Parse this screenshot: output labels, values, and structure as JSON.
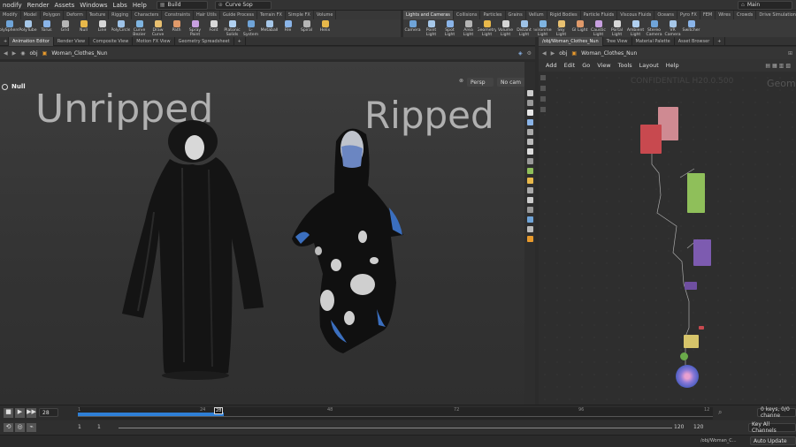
{
  "menubar": {
    "items": [
      "nodify",
      "Render",
      "Assets",
      "Windows",
      "Labs",
      "Help"
    ],
    "desktop": "Build",
    "network_selector": "Curve Sop",
    "right_label": "Main"
  },
  "shelf_left": {
    "tabs": [
      "Modify",
      "Model",
      "Polygon",
      "Deform",
      "Texture",
      "Rigging",
      "Characters",
      "Constraints",
      "Hair Utils",
      "Guide Process",
      "Terrain FX",
      "Simple FX",
      "Volume"
    ],
    "tools": [
      "olySphere",
      "PolyTube",
      "Torus",
      "Grid",
      "Null",
      "Line",
      "PolyCircle",
      "Curve Bezier",
      "Draw Curve",
      "Path",
      "Spray Paint",
      "Font",
      "Platonic Solids",
      "L-System",
      "Metaball",
      "File",
      "Spiral",
      "Helix"
    ]
  },
  "shelf_right": {
    "tabs": [
      "Lights and Cameras",
      "Collisions",
      "Particles",
      "Grains",
      "Vellum",
      "Rigid Bodies",
      "Particle Fluids",
      "Viscous Fluids",
      "Oceans",
      "Pyro FX",
      "FEM",
      "Wires",
      "Crowds",
      "Drive Simulation"
    ],
    "tools": [
      "Camera",
      "Point Light",
      "Spot Light",
      "Area Light",
      "Geometry Light",
      "Volume Light",
      "Distant Light",
      "Environment Light",
      "Sky Light",
      "GI Light",
      "Caustic Light",
      "Portal Light",
      "Ambient Light",
      "Stereo Camera",
      "VR Camera",
      "Switcher"
    ]
  },
  "left_pane_tabs": [
    "Animation Editor",
    "Render View",
    "Composite View",
    "Motion FX View",
    "Geometry Spreadsheet"
  ],
  "right_pane_tabs": [
    "/obj/Woman_Clothes_Nun",
    "Tree View",
    "Material Palette",
    "Asset Browser"
  ],
  "left_path": {
    "ctx": "obj",
    "node": "Woman_Clothes_Nun"
  },
  "right_path": {
    "ctx": "obj",
    "node": "Woman_Clothes_Nun"
  },
  "viewport": {
    "selected": "Null",
    "label_left": "Unripped",
    "label_right": "Ripped",
    "camera_menu": "Persp",
    "cam_menu": "No cam"
  },
  "network": {
    "menu": [
      "Add",
      "Edit",
      "Go",
      "View",
      "Tools",
      "Layout",
      "Help"
    ],
    "watermark": "CONFIDENTIAL H20.0.500",
    "context": "Geom"
  },
  "timeline": {
    "frame": "28",
    "current_marker": "28",
    "ticks": [
      "1",
      "24",
      "48",
      "72",
      "96",
      "12"
    ],
    "start": "1",
    "start2": "1",
    "end": "120",
    "end2": "120",
    "progress_frac": 0.23
  },
  "status": {
    "keys": "0 keys, 0/0 channe",
    "key_all": "Key All Channels",
    "auto": "Auto Update",
    "path": "/obj/Woman_C..."
  },
  "colors": {
    "accent": "#e89a2c",
    "timebar": "#2e7fd6",
    "node_red": "#c8494f",
    "node_pink": "#d08a90",
    "node_green": "#8fbf5a",
    "node_purple": "#7d5bb0",
    "node_yellow": "#d6c46a"
  }
}
